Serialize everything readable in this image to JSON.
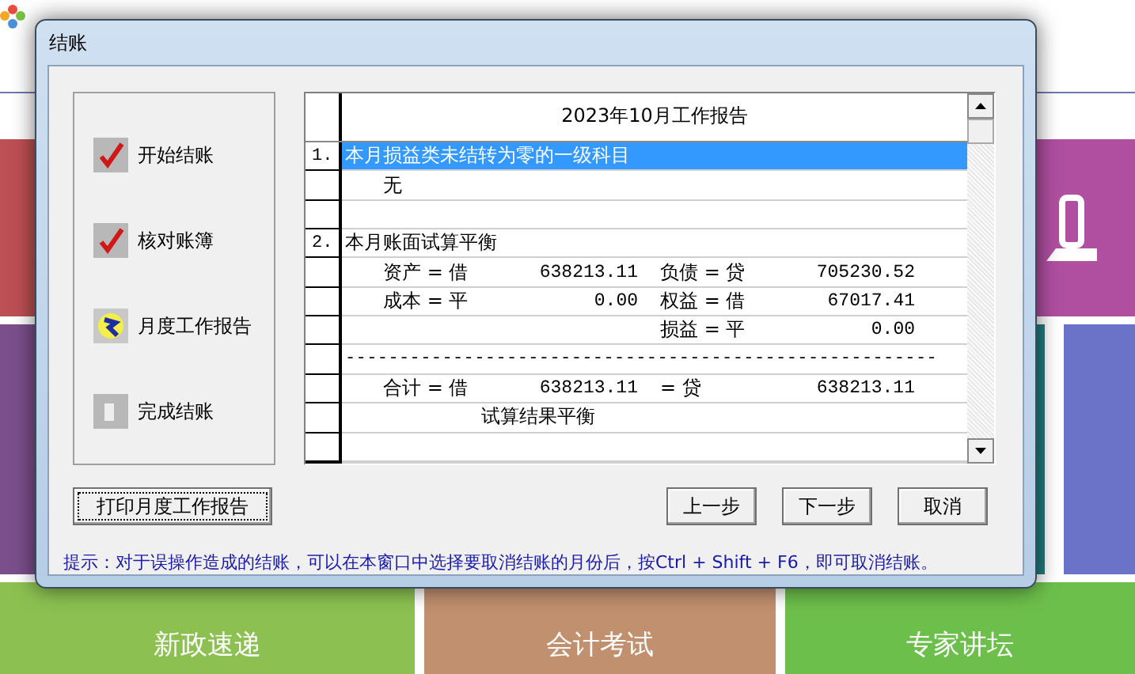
{
  "window": {
    "title": "结账"
  },
  "steps": [
    {
      "label": "开始结账",
      "done": true,
      "selected": false
    },
    {
      "label": "核对账簿",
      "done": true,
      "selected": false
    },
    {
      "label": "月度工作报告",
      "done": false,
      "selected": true
    },
    {
      "label": "完成结账",
      "done": false,
      "selected": false
    }
  ],
  "report": {
    "title": "2023年10月工作报告",
    "rows": [
      {
        "kind": "heading",
        "index": "1.",
        "text": "本月损益类未结转为零的一级科目",
        "selected": true
      },
      {
        "kind": "text",
        "text": "无",
        "selected": false
      },
      {
        "kind": "blank",
        "selected": false
      },
      {
        "kind": "heading",
        "index": "2.",
        "text": "本月账面试算平衡",
        "selected": false
      },
      {
        "kind": "balance",
        "left_label": "资产 = 借",
        "left_value": "638213.11",
        "right_label": "负债 = 贷",
        "right_value": "705230.52",
        "selected": false
      },
      {
        "kind": "balance",
        "left_label": "成本 = 平",
        "left_value": "0.00",
        "right_label": "权益 = 借",
        "right_value": "67017.41",
        "selected": false
      },
      {
        "kind": "balance",
        "right_label": "损益 = 平",
        "right_value": "0.00",
        "selected": false
      },
      {
        "kind": "separator",
        "text": "-------------------------------------------------------",
        "selected": false
      },
      {
        "kind": "balance",
        "left_label": "合计 = 借",
        "left_value": "638213.11",
        "right_label": "= 贷",
        "right_value": "638213.11",
        "selected": false
      },
      {
        "kind": "result",
        "text": "试算结果平衡",
        "selected": false
      },
      {
        "kind": "blank",
        "selected": false
      }
    ]
  },
  "print_button": "打印月度工作报告",
  "nav_buttons": [
    "上一步",
    "下一步",
    "取消"
  ],
  "hint": "提示：对于误操作造成的结账，可以在本窗口中选择要取消结账的月份后，按Ctrl + Shift + F6，即可取消结账。",
  "tiles": [
    {
      "label": "新政速递",
      "color": "#8cc152"
    },
    {
      "label": "会计考试",
      "color": "#c0906f"
    },
    {
      "label": "专家讲坛",
      "color": "#6dbf4b"
    }
  ]
}
